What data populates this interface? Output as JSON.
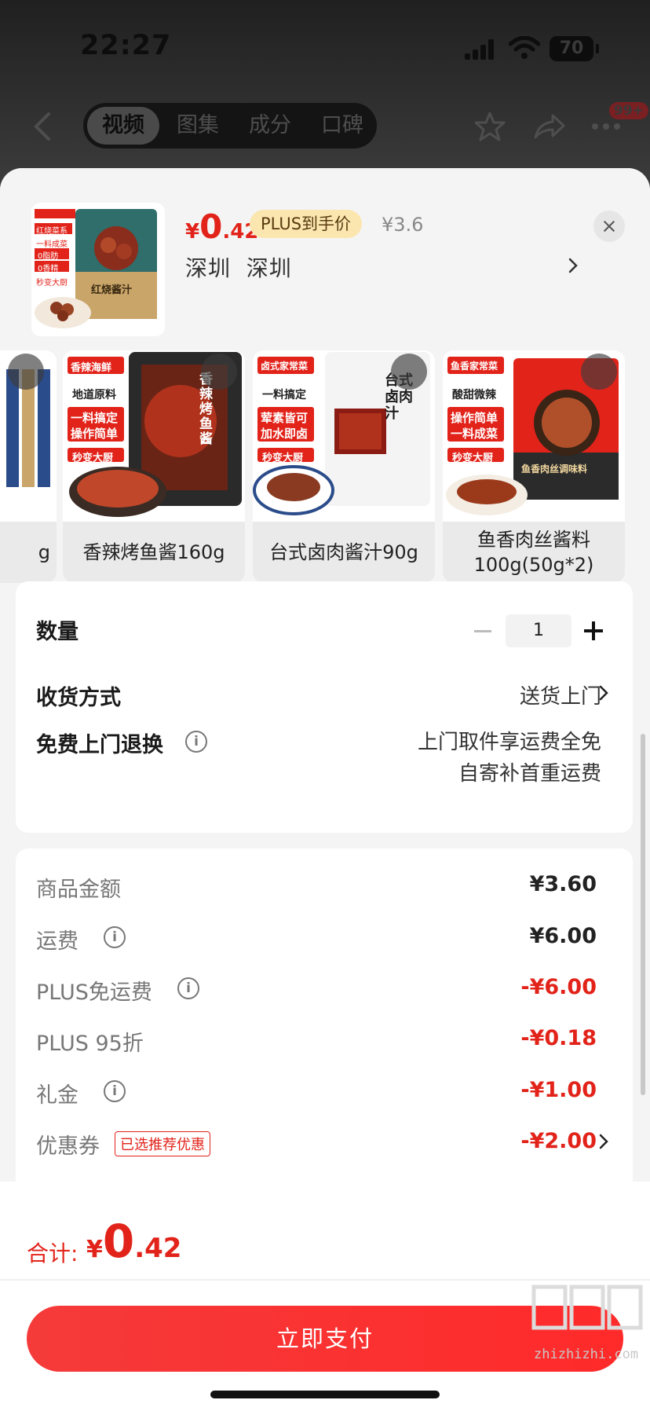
{
  "status_bar": {
    "time": "22:27",
    "battery": "70"
  },
  "nav": {
    "tabs": [
      {
        "label": "视频",
        "active": true
      },
      {
        "label": "图集",
        "active": false
      },
      {
        "label": "成分",
        "active": false
      },
      {
        "label": "口碑",
        "active": false
      }
    ],
    "badge": "99+"
  },
  "product": {
    "price": {
      "symbol": "¥",
      "integer": "0",
      "decimal": ".42"
    },
    "plus_tag": "PLUS到手价",
    "original_price": "¥3.6",
    "location": "深圳  深圳",
    "thumb_text": [
      "红烧酱汁",
      "红烧菜系",
      "一料成菜",
      "0脂肪",
      "0香精",
      "秒变大厨"
    ]
  },
  "variants": [
    {
      "label": "g",
      "tags": []
    },
    {
      "label": "香辣烤鱼酱160g",
      "tags": [
        "香辣海鲜",
        "地道原料",
        "一料搞定",
        "操作简单",
        "秒变大厨"
      ],
      "pkg_title": "香辣烤鱼酱"
    },
    {
      "label": "台式卤肉酱汁90g",
      "tags": [
        "卤式家常菜",
        "一料搞定",
        "荤素皆可",
        "加水即卤",
        "秒变大厨"
      ],
      "pkg_title": "台式卤肉汁"
    },
    {
      "label": "鱼香肉丝酱料\n100g(50g*2)",
      "tags": [
        "鱼香家常菜",
        "酸甜微辣",
        "操作简单",
        "一料成菜",
        "秒变大厨"
      ],
      "pkg_title": "鱼香肉丝调味料"
    }
  ],
  "options": {
    "quantity_label": "数量",
    "quantity_value": "1",
    "delivery_label": "收货方式",
    "delivery_value": "送货上门",
    "return_label": "免费上门退换",
    "return_line1": "上门取件享运费全免",
    "return_line2": "自寄补首重运费"
  },
  "fees": [
    {
      "label": "商品金额",
      "value": "¥3.60",
      "red": false,
      "info": false
    },
    {
      "label": "运费",
      "value": "¥6.00",
      "red": false,
      "info": true
    },
    {
      "label": "PLUS免运费",
      "value": "-¥6.00",
      "red": true,
      "info": true
    },
    {
      "label": "PLUS 95折",
      "value": "-¥0.18",
      "red": true,
      "info": false
    },
    {
      "label": "礼金",
      "value": "-¥1.00",
      "red": true,
      "info": true
    },
    {
      "label": "优惠券",
      "value": "-¥2.00",
      "red": true,
      "info": false,
      "tag": "已选推荐优惠"
    }
  ],
  "footer": {
    "total_label": "合计:",
    "total": {
      "symbol": "¥",
      "integer": "0",
      "decimal": ".42"
    },
    "pay_button": "立即支付",
    "watermark": "zhizhizhi.com"
  },
  "colors": {
    "accent": "#e2231a",
    "plus_tag_bg": "#fbe6b0",
    "background": "#f4f4f4"
  }
}
